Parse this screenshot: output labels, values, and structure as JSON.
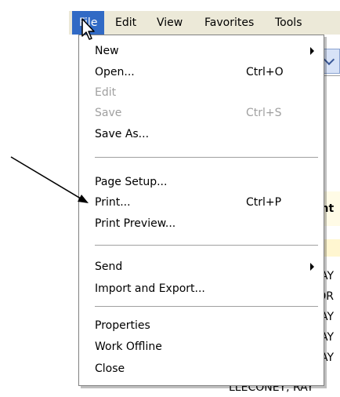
{
  "menubar": {
    "items": [
      {
        "label": "File",
        "active": true
      },
      {
        "label": "Edit"
      },
      {
        "label": "View"
      },
      {
        "label": "Favorites"
      },
      {
        "label": "Tools"
      }
    ]
  },
  "file_menu": {
    "items": [
      {
        "label": "New",
        "shortcut": "",
        "disabled": false,
        "submenu": true
      },
      {
        "label": "Open...",
        "shortcut": "Ctrl+O",
        "disabled": false
      },
      {
        "label": "Edit",
        "shortcut": "",
        "disabled": true
      },
      {
        "label": "Save",
        "shortcut": "Ctrl+S",
        "disabled": true
      },
      {
        "label": "Save As...",
        "shortcut": "",
        "disabled": false
      },
      {
        "label": "Page Setup...",
        "shortcut": "",
        "disabled": false
      },
      {
        "label": "Print...",
        "shortcut": "Ctrl+P",
        "disabled": false
      },
      {
        "label": "Print Preview...",
        "shortcut": "",
        "disabled": false
      },
      {
        "label": "Send",
        "shortcut": "",
        "disabled": false,
        "submenu": true
      },
      {
        "label": "Import and Export...",
        "shortcut": "",
        "disabled": false
      },
      {
        "label": "Properties",
        "shortcut": "",
        "disabled": false
      },
      {
        "label": "Work Offline",
        "shortcut": "",
        "disabled": false
      },
      {
        "label": "Close",
        "shortcut": "",
        "disabled": false
      }
    ]
  },
  "background": {
    "header_fragment": "ent",
    "cells": [
      "AY",
      "IDR",
      "AY",
      "AY",
      "AY"
    ],
    "bottom_cell": "LLECONEY, RAY"
  },
  "colors": {
    "menubar_bg": "#ece9d8",
    "highlight": "#316ac5",
    "disabled_text": "#a0a0a0"
  },
  "icons": {
    "cursor": "mouse-pointer-icon",
    "annotation": "annotation-arrow-icon",
    "submenu": "submenu-arrow-icon"
  }
}
